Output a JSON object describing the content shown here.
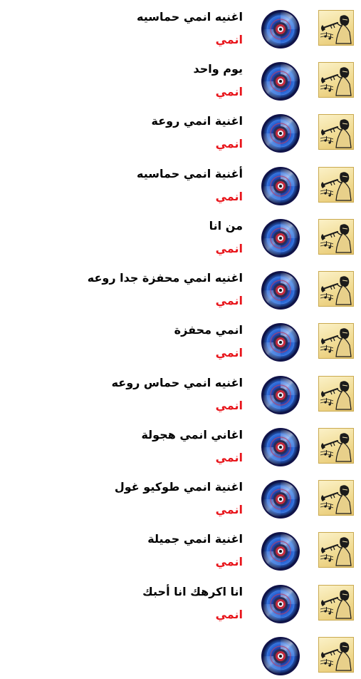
{
  "theme": {
    "subtitle_color": "#e8141a",
    "title_color": "#000000"
  },
  "songs": [
    {
      "title": "اغنيه انمي حماسيه",
      "subtitle": "انمي",
      "thumb_icon": "trumpet-player-icon",
      "disc_icon": "cd-disc-icon"
    },
    {
      "title": "يوم واحد",
      "subtitle": "انمي",
      "thumb_icon": "trumpet-player-icon",
      "disc_icon": "cd-disc-icon"
    },
    {
      "title": "اغنية انمي روعة",
      "subtitle": "انمي",
      "thumb_icon": "trumpet-player-icon",
      "disc_icon": "cd-disc-icon"
    },
    {
      "title": "أغنية انمي حماسيه",
      "subtitle": "انمي",
      "thumb_icon": "trumpet-player-icon",
      "disc_icon": "cd-disc-icon"
    },
    {
      "title": "من انا",
      "subtitle": "انمي",
      "thumb_icon": "trumpet-player-icon",
      "disc_icon": "cd-disc-icon"
    },
    {
      "title": "اغنيه انمي محفزة جدا روعه",
      "subtitle": "انمي",
      "thumb_icon": "trumpet-player-icon",
      "disc_icon": "cd-disc-icon"
    },
    {
      "title": "انمي محفزة",
      "subtitle": "انمي",
      "thumb_icon": "trumpet-player-icon",
      "disc_icon": "cd-disc-icon"
    },
    {
      "title": "اغنيه انمي حماس روعه",
      "subtitle": "انمي",
      "thumb_icon": "trumpet-player-icon",
      "disc_icon": "cd-disc-icon"
    },
    {
      "title": "اغاني انمي هجولة",
      "subtitle": "انمي",
      "thumb_icon": "trumpet-player-icon",
      "disc_icon": "cd-disc-icon"
    },
    {
      "title": "اغنية انمي طوكيو غول",
      "subtitle": "انمي",
      "thumb_icon": "trumpet-player-icon",
      "disc_icon": "cd-disc-icon"
    },
    {
      "title": "اغنية انمي جميلة",
      "subtitle": "انمي",
      "thumb_icon": "trumpet-player-icon",
      "disc_icon": "cd-disc-icon"
    },
    {
      "title": "انا اكرهك انا أحبك",
      "subtitle": "انمي",
      "thumb_icon": "trumpet-player-icon",
      "disc_icon": "cd-disc-icon"
    },
    {
      "title": "",
      "subtitle": "",
      "thumb_icon": "trumpet-player-icon",
      "disc_icon": "cd-disc-icon"
    }
  ]
}
